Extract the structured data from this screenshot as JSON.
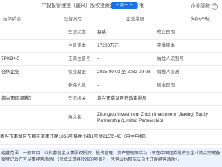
{
  "header": {
    "title": "中投投管理投（嘉兴）股权投资合伙企业（有限",
    "add_button": "加一下",
    "right_text": "企业简称",
    "qicon": "?"
  },
  "table": {
    "header": {
      "c1": "法律诉讼",
      "c2": "经营风险",
      "c3": "企业发展",
      "c4": "知识产权"
    },
    "rows": [
      {
        "l1": "",
        "v1": "",
        "l2": "登记状态",
        "v2": "存续",
        "l3": "成立日期",
        "v3": ""
      },
      {
        "l1": "",
        "v1": "",
        "l2": "注册资本",
        "v2": "17200万元",
        "l3": "实缴资本",
        "v3": ""
      },
      {
        "l1": "7PK2K-5",
        "v1": "",
        "l2": "工商注册号",
        "v2": "-",
        "l3": "纳税人识别号",
        "v3": ""
      },
      {
        "l1": "合伙企业",
        "v1": "",
        "l2": "营业期限",
        "v2": "2025-09-03 至 2032-09-08",
        "l3": "纳税人资质",
        "v3": ""
      },
      {
        "l1": "",
        "v1": "",
        "l2": "参保人数",
        "v2": "-",
        "l3": "核准日期",
        "v3": ""
      },
      {
        "l1": "嘉兴市南湖新区",
        "v1": "",
        "l2": "登记机关",
        "v2": "嘉兴市南湖区行政审批局",
        "l3": "",
        "v3": ""
      }
    ],
    "english_row": {
      "l2": "英文名",
      "value": "Zhongtou Investment Zhixin Investment (Jiaxing) Equity Partnership (Limited Partnership)"
    },
    "address": "嘉兴市南湖区东栅街道南江路1856号基金小镇1号楼215室-45（自主申报）"
  },
  "scope": {
    "text": "经营范围：一般项目：以私募基金从事股权投资、投资管理、资产管理等活动（须在中国证券投资基金业协会完成备案登记后方可从事经营活动）（除依法须经批准的项目外，凭营业执照依法自主开展经营活动）。"
  }
}
